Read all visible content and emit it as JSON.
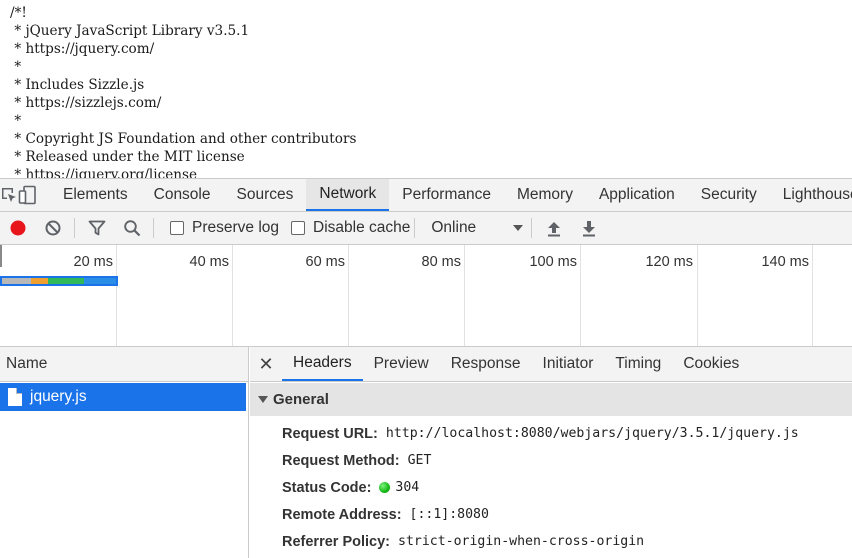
{
  "source": {
    "lines": [
      "/*!",
      " * jQuery JavaScript Library v3.5.1",
      " * https://jquery.com/",
      " *",
      " * Includes Sizzle.js",
      " * https://sizzlejs.com/",
      " *",
      " * Copyright JS Foundation and other contributors",
      " * Released under the MIT license",
      " * https://jquery.org/license"
    ]
  },
  "devtools": {
    "tabs": [
      "Elements",
      "Console",
      "Sources",
      "Network",
      "Performance",
      "Memory",
      "Application",
      "Security",
      "Lighthouse"
    ],
    "active_tab": "Network",
    "icons": [
      "inspect-element-icon",
      "device-toolbar-icon"
    ]
  },
  "network_toolbar": {
    "preserve_log": "Preserve log",
    "disable_cache": "Disable cache",
    "throttling": "Online",
    "icons": [
      "record-icon",
      "clear-icon",
      "filter-icon",
      "search-icon",
      "import-har-icon",
      "export-har-icon"
    ]
  },
  "overview": {
    "ticks": [
      "20 ms",
      "40 ms",
      "60 ms",
      "80 ms",
      "100 ms",
      "120 ms",
      "140 ms"
    ],
    "bar_segments": [
      {
        "color": "#b8b8b8",
        "fraction": 0.25
      },
      {
        "color": "#f0a030",
        "fraction": 0.15
      },
      {
        "color": "#31b858",
        "fraction": 0.32
      },
      {
        "color": "#2a8ee6",
        "fraction": 0.28
      }
    ]
  },
  "name_column": {
    "header": "Name",
    "rows": [
      "jquery.js"
    ]
  },
  "details": {
    "tabs": [
      "Headers",
      "Preview",
      "Response",
      "Initiator",
      "Timing",
      "Cookies"
    ],
    "active_tab": "Headers",
    "section": "General",
    "fields": [
      {
        "key": "Request URL:",
        "value": "http://localhost:8080/webjars/jquery/3.5.1/jquery.js"
      },
      {
        "key": "Request Method:",
        "value": "GET"
      },
      {
        "key": "Status Code:",
        "value": "304"
      },
      {
        "key": "Remote Address:",
        "value": "[::1]:8080"
      },
      {
        "key": "Referrer Policy:",
        "value": "strict-origin-when-cross-origin"
      }
    ]
  },
  "colors": {
    "accent": "#1a73e8",
    "record": "#e8161b",
    "status_ok": "#14b814"
  }
}
